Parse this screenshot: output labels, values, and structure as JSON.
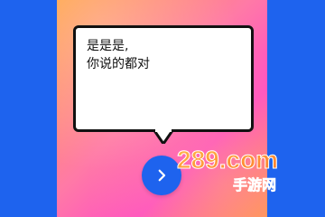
{
  "dialog": {
    "message": "是是是,\n你说的都对"
  },
  "controls": {
    "next_button_icon": "chevron-right-icon",
    "accent_color": "#1e63ee"
  },
  "watermark": {
    "text": "289.com 手游网"
  }
}
